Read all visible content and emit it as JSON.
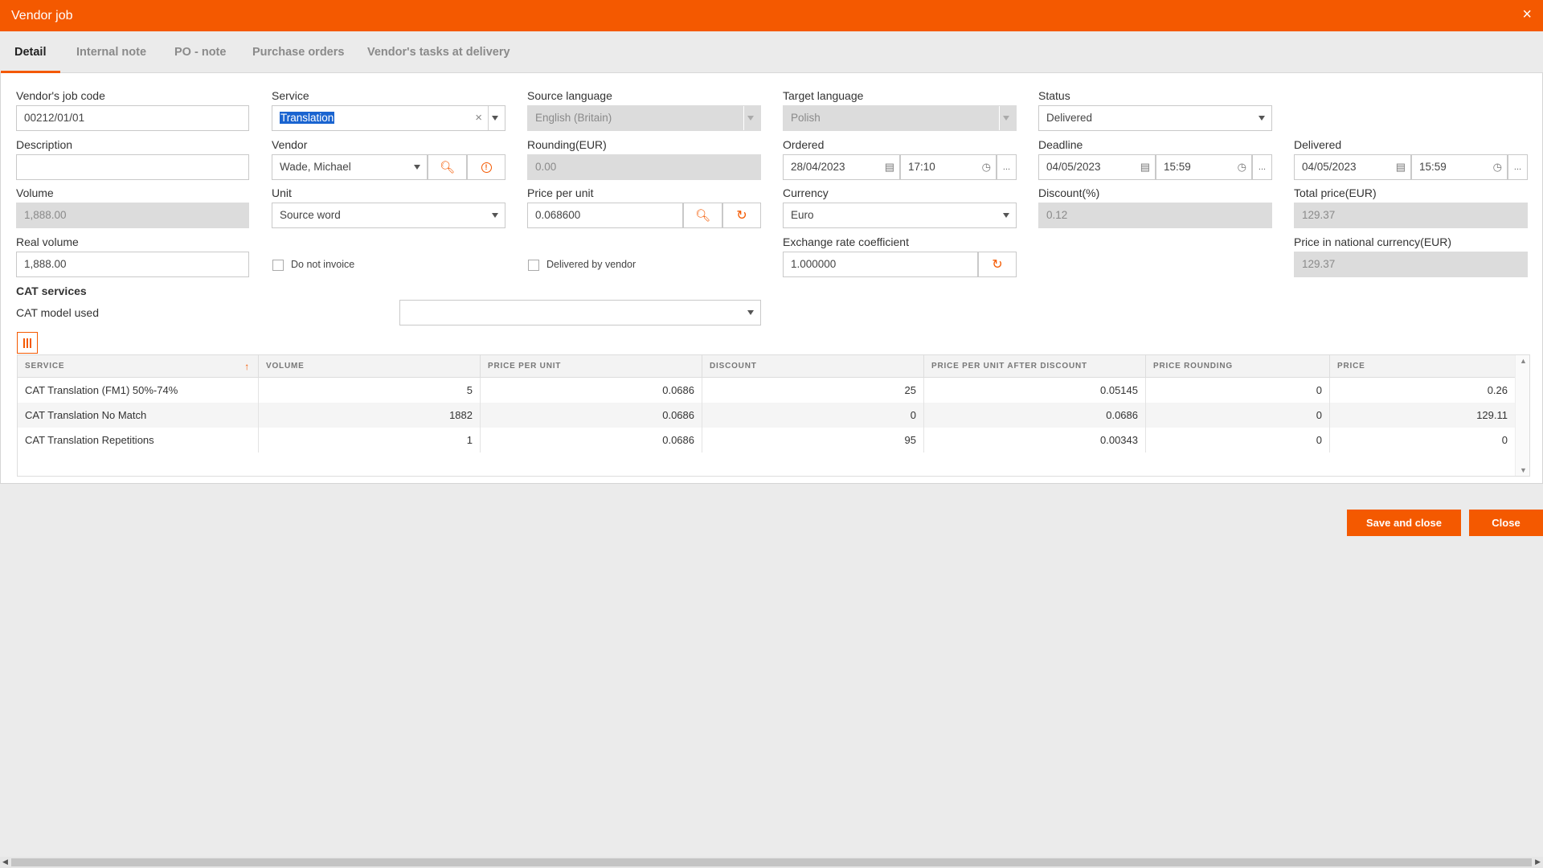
{
  "window": {
    "title": "Vendor job",
    "close_icon": "×"
  },
  "tabs": [
    "Detail",
    "Internal note",
    "PO - note",
    "Purchase orders",
    "Vendor's tasks at delivery"
  ],
  "form": {
    "vendors_job_code": {
      "label": "Vendor's job code",
      "value": "00212/01/01"
    },
    "service": {
      "label": "Service",
      "value": "Translation"
    },
    "source_language": {
      "label": "Source language",
      "value": "English (Britain)"
    },
    "target_language": {
      "label": "Target language",
      "value": "Polish"
    },
    "status": {
      "label": "Status",
      "value": "Delivered"
    },
    "description": {
      "label": "Description",
      "value": ""
    },
    "vendor": {
      "label": "Vendor",
      "value": "Wade, Michael"
    },
    "rounding": {
      "label": "Rounding(EUR)",
      "value": "0.00"
    },
    "ordered": {
      "label": "Ordered",
      "date": "28/04/2023",
      "time": "17:10"
    },
    "deadline": {
      "label": "Deadline",
      "date": "04/05/2023",
      "time": "15:59"
    },
    "delivered": {
      "label": "Delivered",
      "date": "04/05/2023",
      "time": "15:59"
    },
    "volume": {
      "label": "Volume",
      "value": "1,888.00"
    },
    "unit": {
      "label": "Unit",
      "value": "Source word"
    },
    "price_per_unit": {
      "label": "Price per unit",
      "value": "0.068600"
    },
    "currency": {
      "label": "Currency",
      "value": "Euro"
    },
    "discount": {
      "label": "Discount(%)",
      "value": "0.12"
    },
    "total_price": {
      "label": "Total price(EUR)",
      "value": "129.37"
    },
    "real_volume": {
      "label": "Real volume",
      "value": "1,888.00"
    },
    "do_not_invoice": {
      "label": "Do not invoice",
      "checked": false
    },
    "delivered_by_vendor": {
      "label": "Delivered by vendor",
      "checked": false
    },
    "exchange_rate": {
      "label": "Exchange rate coefficient",
      "value": "1.000000"
    },
    "price_national": {
      "label": "Price in national currency(EUR)",
      "value": "129.37"
    },
    "more_label": "..."
  },
  "cat": {
    "section_title": "CAT services",
    "model_label": "CAT model used",
    "model_value": "",
    "columns": [
      "SERVICE",
      "VOLUME",
      "PRICE PER UNIT",
      "DISCOUNT",
      "PRICE PER UNIT AFTER DISCOUNT",
      "PRICE ROUNDING",
      "PRICE"
    ],
    "sort_icon": "↑",
    "rows": [
      {
        "service": "CAT Translation (FM1) 50%-74%",
        "volume": "5",
        "price_per_unit": "0.0686",
        "discount": "25",
        "after_discount": "0.05145",
        "rounding": "0",
        "price": "0.26"
      },
      {
        "service": "CAT Translation No Match",
        "volume": "1882",
        "price_per_unit": "0.0686",
        "discount": "0",
        "after_discount": "0.0686",
        "rounding": "0",
        "price": "129.11"
      },
      {
        "service": "CAT Translation Repetitions",
        "volume": "1",
        "price_per_unit": "0.0686",
        "discount": "95",
        "after_discount": "0.00343",
        "rounding": "0",
        "price": "0"
      }
    ]
  },
  "actions": {
    "save_close": "Save and close",
    "close": "Close"
  },
  "colors": {
    "accent": "#f45900",
    "readonly_bg": "#dcdcdc",
    "selection": "#1a64d0"
  }
}
